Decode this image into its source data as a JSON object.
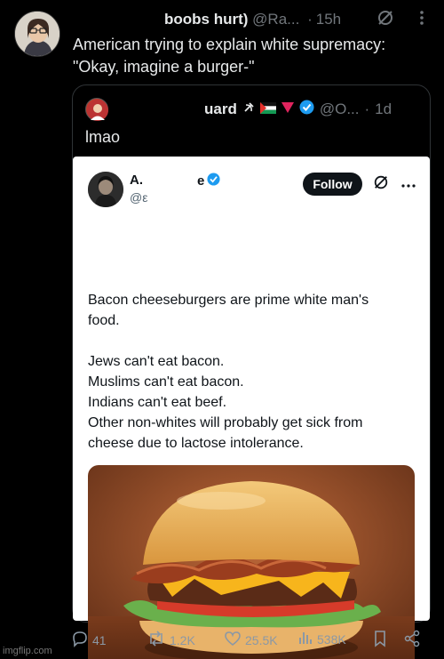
{
  "outer_tweet": {
    "name": "boobs hurt)",
    "handle": "@Ra...",
    "time": "15h",
    "text_line1": "American trying to explain white supremacy:",
    "text_line2": "\"Okay, imagine a burger-\""
  },
  "quoted_tweet": {
    "name": "uard",
    "handle": "@O...",
    "time": "1d",
    "text": "lmao"
  },
  "embedded_post": {
    "name": "A.",
    "name_suffix": "e",
    "handle": "@ε",
    "follow_label": "Follow",
    "lines": [
      "Bacon cheeseburgers are prime white man's",
      "food.",
      "",
      "Jews can't eat bacon.",
      "Muslims can't eat bacon.",
      "Indians can't eat beef.",
      "Other non-whites will probably get sick from",
      "cheese due to lactose intolerance."
    ]
  },
  "actions": {
    "replies": "41",
    "reposts": "1.2K",
    "likes": "25.5K",
    "views": "538K"
  },
  "watermark": "imgflip.com",
  "icons": [
    "grok-icon",
    "more-icon",
    "hammer-sickle-icon",
    "flag-icon",
    "triangle-icon",
    "verified-icon",
    "reply-icon",
    "repost-icon",
    "like-icon",
    "views-icon",
    "bookmark-icon",
    "share-icon"
  ]
}
